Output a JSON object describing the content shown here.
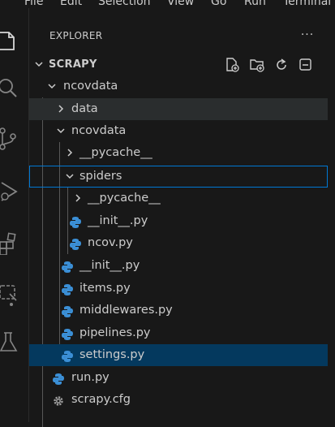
{
  "menubar": {
    "items": [
      "File",
      "Edit",
      "Selection",
      "View",
      "Go",
      "Run",
      "Terminal"
    ]
  },
  "activity_bar": {
    "icons": [
      "explorer-icon",
      "search-icon",
      "source-control-icon",
      "run-debug-icon",
      "extensions-icon",
      "remote-explorer-icon",
      "testing-icon"
    ]
  },
  "explorer": {
    "title": "EXPLORER",
    "more_label": "···",
    "toolbar": [
      "new-file-icon",
      "new-folder-icon",
      "refresh-icon",
      "collapse-all-icon"
    ]
  },
  "tree": {
    "root": "SCRAPY",
    "items": [
      {
        "label": "ncovdata",
        "type": "folder",
        "expanded": true
      },
      {
        "label": "data",
        "type": "folder",
        "expanded": false
      },
      {
        "label": "ncovdata",
        "type": "folder",
        "expanded": true
      },
      {
        "label": "__pycache__",
        "type": "folder",
        "expanded": false
      },
      {
        "label": "spiders",
        "type": "folder",
        "expanded": true
      },
      {
        "label": "__pycache__",
        "type": "folder",
        "expanded": false
      },
      {
        "label": "__init__.py",
        "type": "python"
      },
      {
        "label": "ncov.py",
        "type": "python"
      },
      {
        "label": "__init__.py",
        "type": "python"
      },
      {
        "label": "items.py",
        "type": "python"
      },
      {
        "label": "middlewares.py",
        "type": "python"
      },
      {
        "label": "pipelines.py",
        "type": "python"
      },
      {
        "label": "settings.py",
        "type": "python"
      },
      {
        "label": "run.py",
        "type": "python"
      },
      {
        "label": "scrapy.cfg",
        "type": "config"
      }
    ]
  },
  "colors": {
    "background": "#181818",
    "selected": "#04395e",
    "focus_border": "#0078d4",
    "hover": "#2a2d2e",
    "python_blue": "#3b8fd6",
    "text": "#cccccc"
  }
}
